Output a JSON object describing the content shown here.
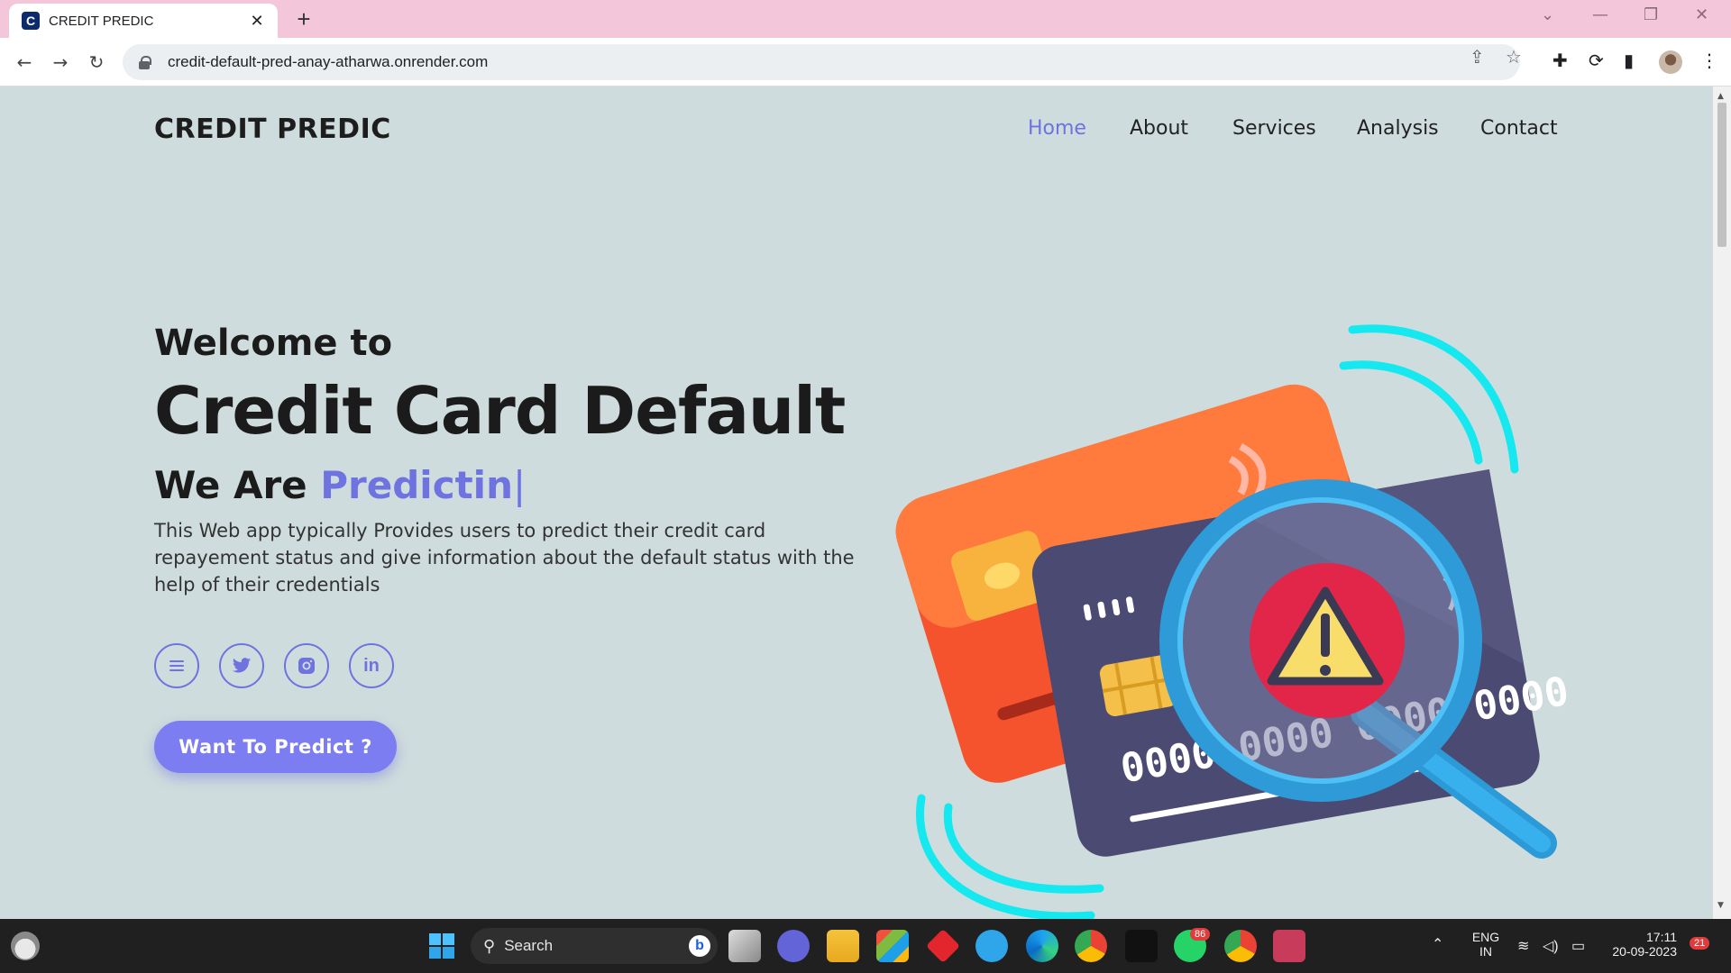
{
  "browser": {
    "tab_title": "CREDIT PREDIC",
    "tab_favicon_letter": "C",
    "new_tab": "+",
    "url": "credit-default-pred-anay-atharwa.onrender.com"
  },
  "site": {
    "brand": "CREDIT PREDIC",
    "nav": [
      {
        "label": "Home",
        "active": true
      },
      {
        "label": "About",
        "active": false
      },
      {
        "label": "Services",
        "active": false
      },
      {
        "label": "Analysis",
        "active": false
      },
      {
        "label": "Contact",
        "active": false
      }
    ],
    "accent_color": "#6f73e0"
  },
  "hero": {
    "welcome": "Welcome to",
    "headline": "Credit Card Default",
    "we_are": "We Are",
    "typed": "Predictin",
    "caret": "|",
    "description": "This Web app typically Provides users to predict their credit card repayement status and give information about the default status with the help of their credentials",
    "socials": [
      "menu-icon",
      "twitter-icon",
      "instagram-icon",
      "linkedin-icon"
    ],
    "linkedin_text": "in",
    "cta": "Want To Predict ?"
  },
  "illustration": {
    "card_number": "0000 0000 0000 0000"
  },
  "taskbar": {
    "search_label": "Search",
    "whatsapp_badge": "86",
    "language": "ENG",
    "region": "IN",
    "time": "17:11",
    "date": "20-09-2023",
    "notification_count": "21"
  }
}
